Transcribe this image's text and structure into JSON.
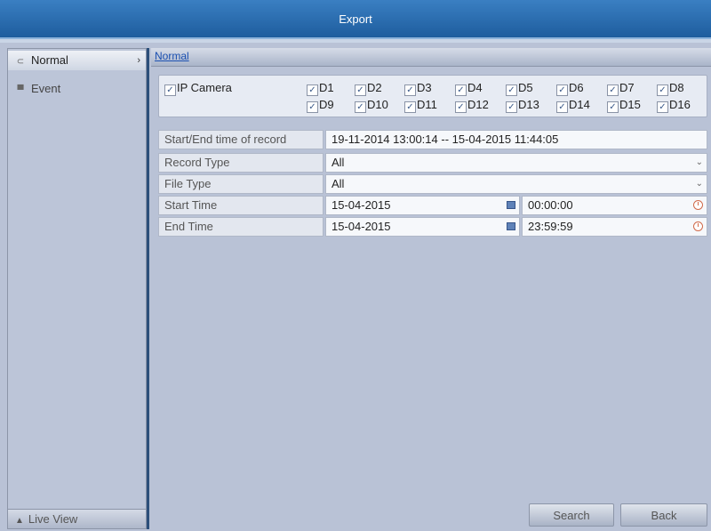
{
  "window": {
    "title": "Export"
  },
  "sidebar": {
    "items": [
      {
        "label": "Normal",
        "icon": "normal-icon",
        "active": true
      },
      {
        "label": "Event",
        "icon": "event-icon",
        "active": false
      }
    ],
    "live_view": "Live View"
  },
  "tabs": [
    {
      "label": "Normal"
    }
  ],
  "ip_camera": {
    "label": "IP Camera",
    "checked": true,
    "channels": [
      "D1",
      "D2",
      "D3",
      "D4",
      "D5",
      "D6",
      "D7",
      "D8",
      "D9",
      "D10",
      "D11",
      "D12",
      "D13",
      "D14",
      "D15",
      "D16"
    ]
  },
  "form": {
    "record_range": {
      "label": "Start/End time of record",
      "value": "19-11-2014 13:00:14 -- 15-04-2015 11:44:05"
    },
    "record_type": {
      "label": "Record Type",
      "value": "All"
    },
    "file_type": {
      "label": "File Type",
      "value": "All"
    },
    "start_time": {
      "label": "Start Time",
      "date": "15-04-2015",
      "time": "00:00:00"
    },
    "end_time": {
      "label": "End Time",
      "date": "15-04-2015",
      "time": "23:59:59"
    }
  },
  "buttons": {
    "search": "Search",
    "back": "Back"
  }
}
